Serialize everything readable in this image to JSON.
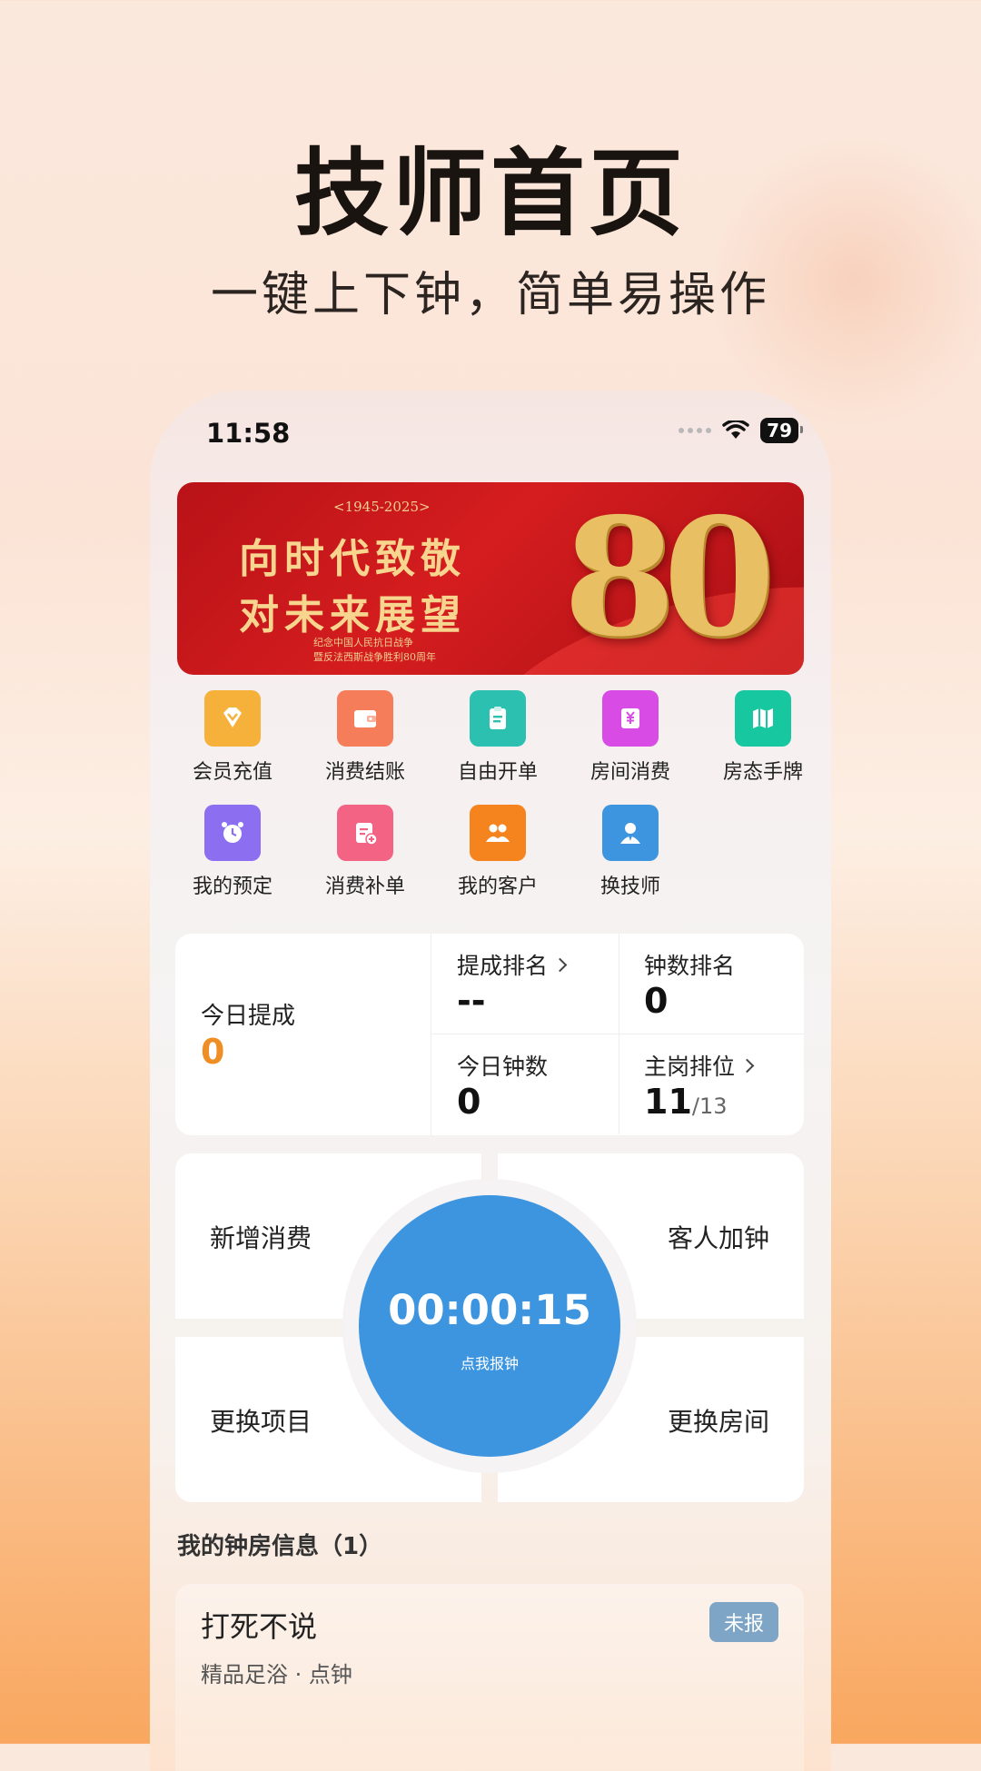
{
  "promo": {
    "title": "技师首页",
    "subtitle": "一键上下钟，简单易操作"
  },
  "status_bar": {
    "time": "11:58",
    "battery": "79"
  },
  "banner": {
    "year": "<1945-2025>",
    "line1": "向时代致敬",
    "line2": "对未来展望",
    "small1": "纪念中国人民抗日战争",
    "small2": "暨反法西斯战争胜利80周年",
    "big_number": "80"
  },
  "grid": [
    {
      "label": "会员充值",
      "icon": "diamond-icon",
      "color": "#f6b13a"
    },
    {
      "label": "消费结账",
      "icon": "wallet-icon",
      "color": "#f57d5a"
    },
    {
      "label": "自由开单",
      "icon": "clipboard-icon",
      "color": "#2cc0b1"
    },
    {
      "label": "房间消费",
      "icon": "yen-receipt-icon",
      "color": "#d84be4"
    },
    {
      "label": "房态手牌",
      "icon": "map-icon",
      "color": "#16c79f"
    },
    {
      "label": "我的预定",
      "icon": "alarm-clock-icon",
      "color": "#8c6ff0"
    },
    {
      "label": "消费补单",
      "icon": "add-document-icon",
      "color": "#f26384"
    },
    {
      "label": "我的客户",
      "icon": "customers-icon",
      "color": "#f5831e"
    },
    {
      "label": "换技师",
      "icon": "person-icon",
      "color": "#3d95e0"
    }
  ],
  "stats": {
    "today_commission_label": "今日提成",
    "today_commission_value": "0",
    "commission_rank_label": "提成排名",
    "commission_rank_value": "--",
    "clock_rank_label": "钟数排名",
    "clock_rank_value": "0",
    "today_clocks_label": "今日钟数",
    "today_clocks_value": "0",
    "queue_label": "主岗排位",
    "queue_value": "11",
    "queue_total": "/13"
  },
  "actions": {
    "add_consumption": "新增消费",
    "add_clock": "客人加钟",
    "change_item": "更换项目",
    "change_room": "更换房间"
  },
  "timer": {
    "value": "00:00:15",
    "hint": "点我报钟"
  },
  "rooms_section": {
    "title": "我的钟房信息（1）"
  },
  "room": {
    "name": "打死不说",
    "badge": "未报",
    "service": "精品足浴 · 点钟"
  },
  "colors": {
    "accent_blue": "#3d95e0",
    "commission_orange": "#ef8e25",
    "badge_blue": "#7ea5c6"
  }
}
